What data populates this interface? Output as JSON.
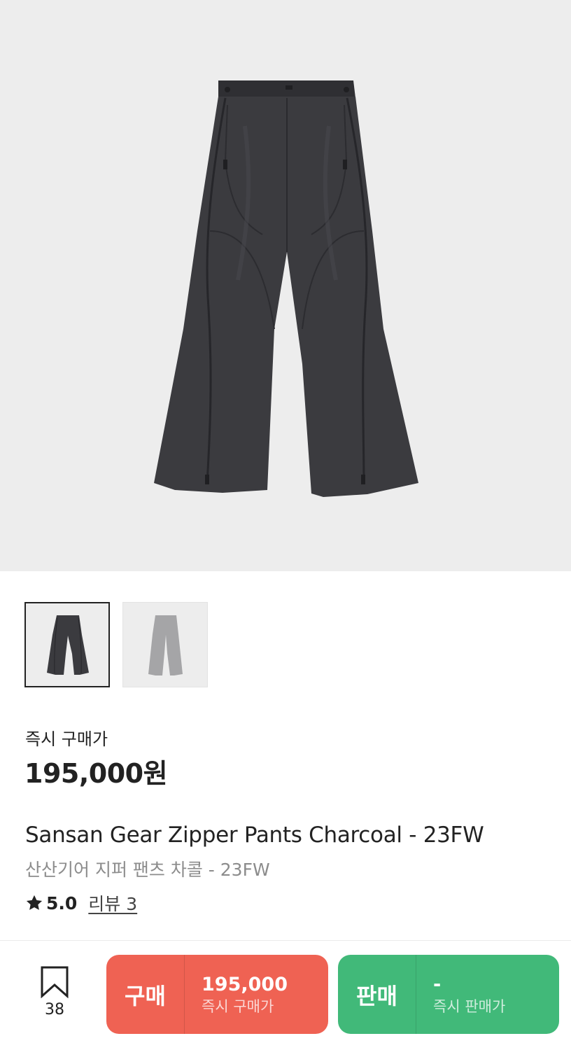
{
  "product": {
    "image_alt": "Sansan Gear Zipper Pants Charcoal",
    "colors": {
      "charcoal": "#3b3b3f",
      "grey": "#a5a5a7",
      "background": "#ededed"
    }
  },
  "thumbnails": [
    {
      "label": "charcoal",
      "selected": true
    },
    {
      "label": "grey",
      "selected": false
    }
  ],
  "price_section": {
    "label": "즉시 구매가",
    "price": "195,000원"
  },
  "title": {
    "english": "Sansan Gear Zipper Pants Charcoal - 23FW",
    "korean": "산산기어 지퍼 팬츠 차콜 - 23FW"
  },
  "rating": {
    "icon": "star-icon",
    "value": "5.0",
    "review_label": "리뷰 3"
  },
  "bottom_bar": {
    "bookmark": {
      "icon": "bookmark-icon",
      "count": "38"
    },
    "buy": {
      "label": "구매",
      "price": "195,000",
      "sub": "즉시 구매가",
      "color": "#ef6253"
    },
    "sell": {
      "label": "판매",
      "price": "-",
      "sub": "즉시 판매가",
      "color": "#41b979"
    }
  }
}
